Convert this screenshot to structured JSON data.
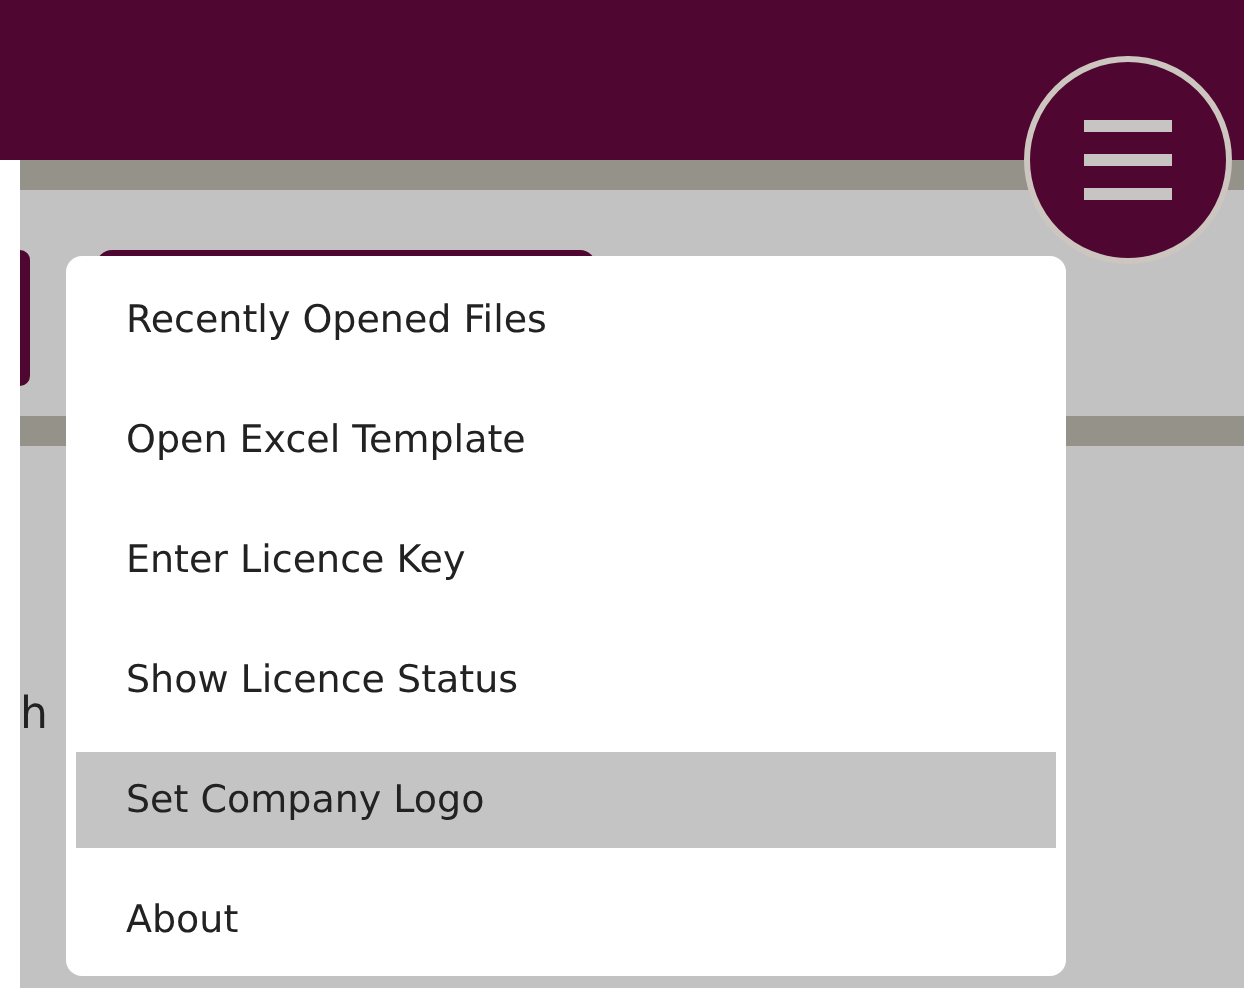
{
  "background": {
    "text_fragment": "h"
  },
  "menu": {
    "items": [
      {
        "label": "Recently Opened Files",
        "selected": false
      },
      {
        "label": "Open Excel Template",
        "selected": false
      },
      {
        "label": "Enter Licence Key",
        "selected": false
      },
      {
        "label": "Show Licence Status",
        "selected": false
      },
      {
        "label": "Set Company Logo",
        "selected": true
      },
      {
        "label": "About",
        "selected": false
      }
    ]
  }
}
